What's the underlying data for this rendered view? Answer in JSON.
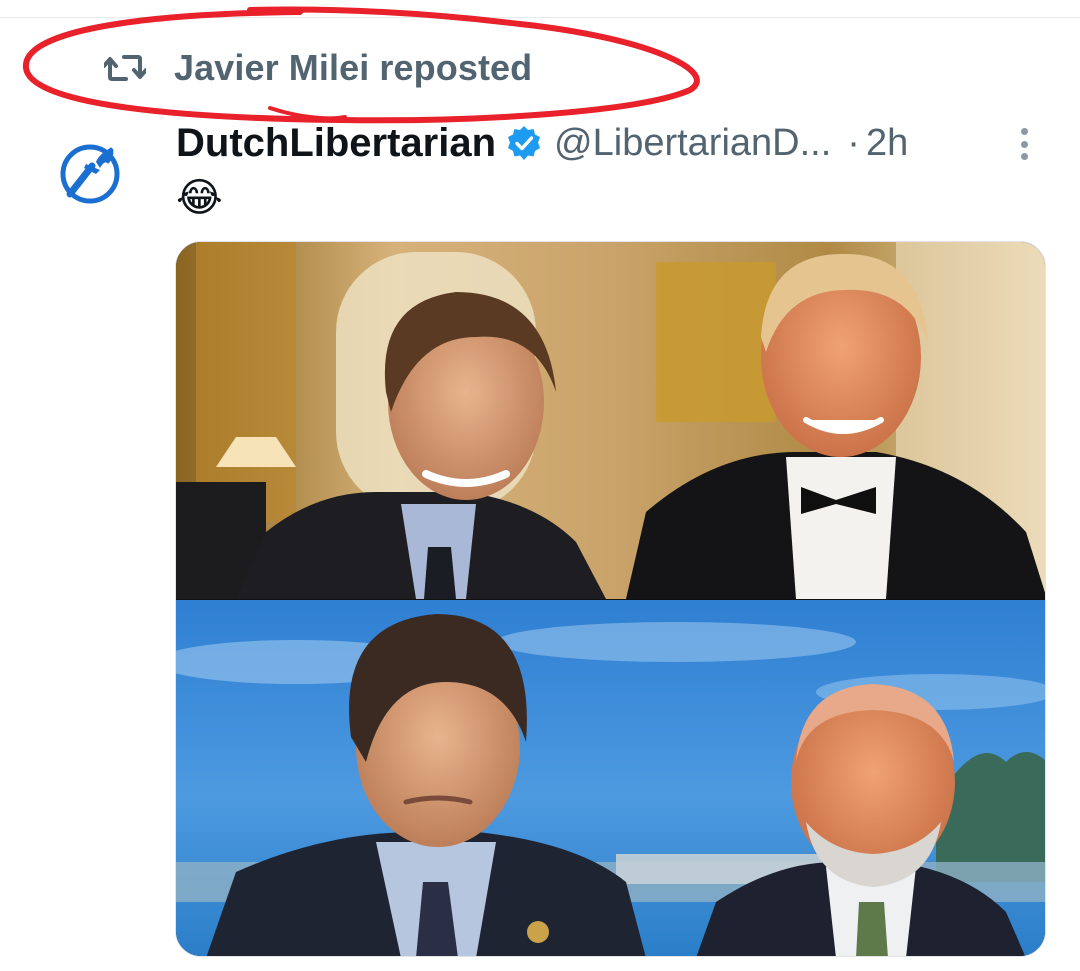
{
  "repost": {
    "label": "Javier Milei reposted",
    "icon": "repost-icon"
  },
  "tweet": {
    "display_name": "DutchLibertarian",
    "verified": true,
    "handle": "@LibertarianD...",
    "separator": "·",
    "time": "2h",
    "text": "😂",
    "avatar_icon": "torch-icon",
    "more_icon": "more-vertical-icon"
  },
  "colors": {
    "secondary_text": "#536471",
    "verified_blue": "#1d9bf0",
    "annotation_red": "#e8212b",
    "avatar_blue": "#1a6fd1"
  },
  "media": {
    "panels": [
      "top-photo",
      "bottom-photo"
    ]
  }
}
